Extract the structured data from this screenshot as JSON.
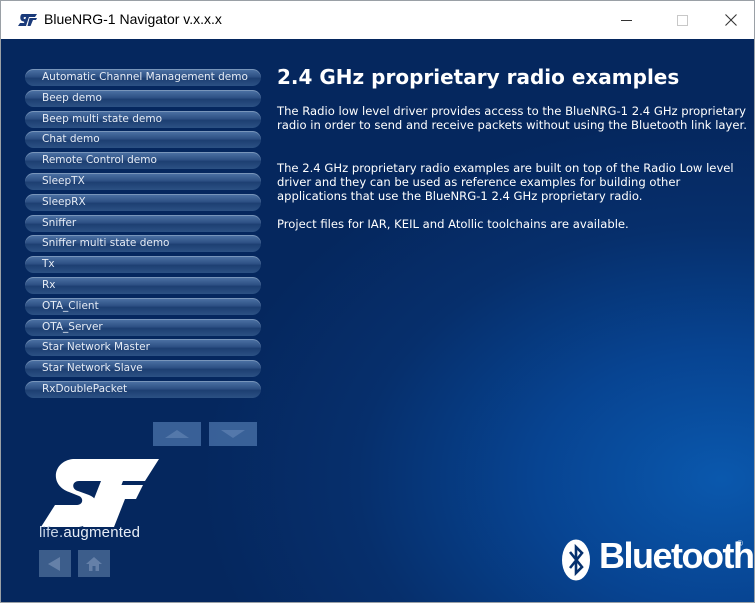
{
  "window": {
    "title": "BlueNRG-1 Navigator v.x.x.x"
  },
  "menu": {
    "items": [
      "Automatic Channel Management demo",
      "Beep demo",
      "Beep multi state demo",
      "Chat demo",
      "Remote Control demo",
      "SleepTX",
      "SleepRX",
      "Sniffer",
      "Sniffer multi state demo",
      "Tx",
      "Rx",
      "OTA_Client",
      "OTA_Server",
      "Star Network Master",
      "Star Network Slave",
      "RxDoublePacket"
    ]
  },
  "content": {
    "heading": "2.4 GHz proprietary radio examples",
    "paragraphs": [
      "The Radio low level driver provides access to the BlueNRG-1 2.4 GHz proprietary radio in order to send and receive packets without using the Bluetooth link layer.",
      "The 2.4 GHz proprietary radio examples are built on top of the Radio Low level driver and they can be used as reference examples for building other applications that use the BlueNRG-1 2.4 GHz proprietary radio.",
      "Project files for IAR, KEIL and Atollic toolchains are available."
    ]
  },
  "branding": {
    "tagline_part1": "life.",
    "tagline_part2": "augmented",
    "bluetooth_word": "Bluetooth",
    "bluetooth_reg": "®"
  },
  "colors": {
    "background_dark": "#05275e",
    "background_light": "#0a58ad",
    "menu_button": "#2e5185",
    "st_logo": "#ffffff"
  },
  "icons": {
    "app": "st-logo-icon",
    "minimize": "minimize-icon",
    "maximize": "maximize-icon",
    "close": "close-icon",
    "scroll_up": "arrow-up-icon",
    "scroll_down": "arrow-down-icon",
    "back": "arrow-left-icon",
    "home": "home-icon",
    "bluetooth": "bluetooth-icon"
  }
}
